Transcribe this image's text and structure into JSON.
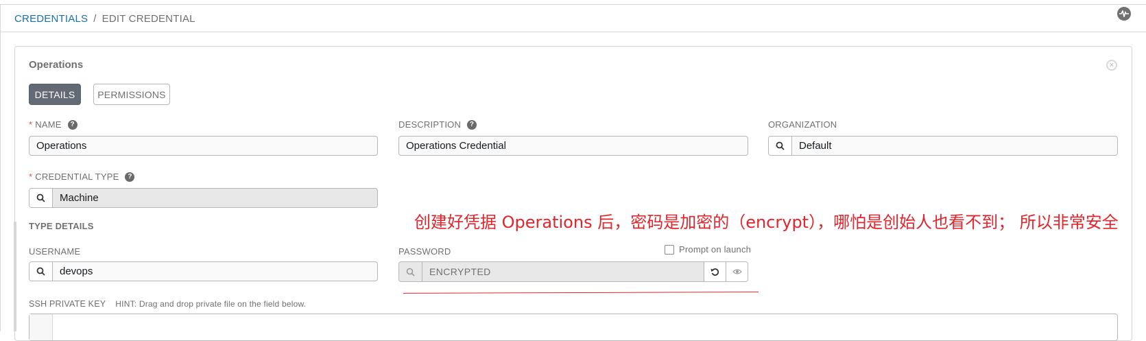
{
  "breadcrumb": {
    "parent": "CREDENTIALS",
    "separator": "/",
    "current": "EDIT CREDENTIAL"
  },
  "panel": {
    "title": "Operations"
  },
  "tabs": [
    {
      "label": "DETAILS",
      "active": true
    },
    {
      "label": "PERMISSIONS",
      "active": false
    }
  ],
  "form": {
    "name": {
      "label": "NAME",
      "required_mark": "*",
      "value": "Operations"
    },
    "description": {
      "label": "DESCRIPTION",
      "value": "Operations Credential"
    },
    "organization": {
      "label": "ORGANIZATION",
      "value": "Default"
    },
    "credential_type": {
      "label": "CREDENTIAL TYPE",
      "required_mark": "*",
      "value": "Machine"
    },
    "type_details_heading": "TYPE DETAILS",
    "username": {
      "label": "USERNAME",
      "value": "devops"
    },
    "password": {
      "label": "PASSWORD",
      "value": "ENCRYPTED",
      "prompt_on_launch_label": "Prompt on launch",
      "prompt_on_launch_checked": false
    },
    "ssh_private_key": {
      "label": "SSH PRIVATE KEY",
      "hint": "HINT: Drag and drop private file on the field below."
    }
  },
  "annotation": {
    "text": "创建好凭据 Operations 后，密码是加密的（encrypt），哪怕是创始人也看不到； 所以非常安全",
    "color": "#e3242b"
  },
  "colors": {
    "link": "#1a6fa8",
    "active_tab": "#636a73",
    "required": "#d9534f"
  }
}
